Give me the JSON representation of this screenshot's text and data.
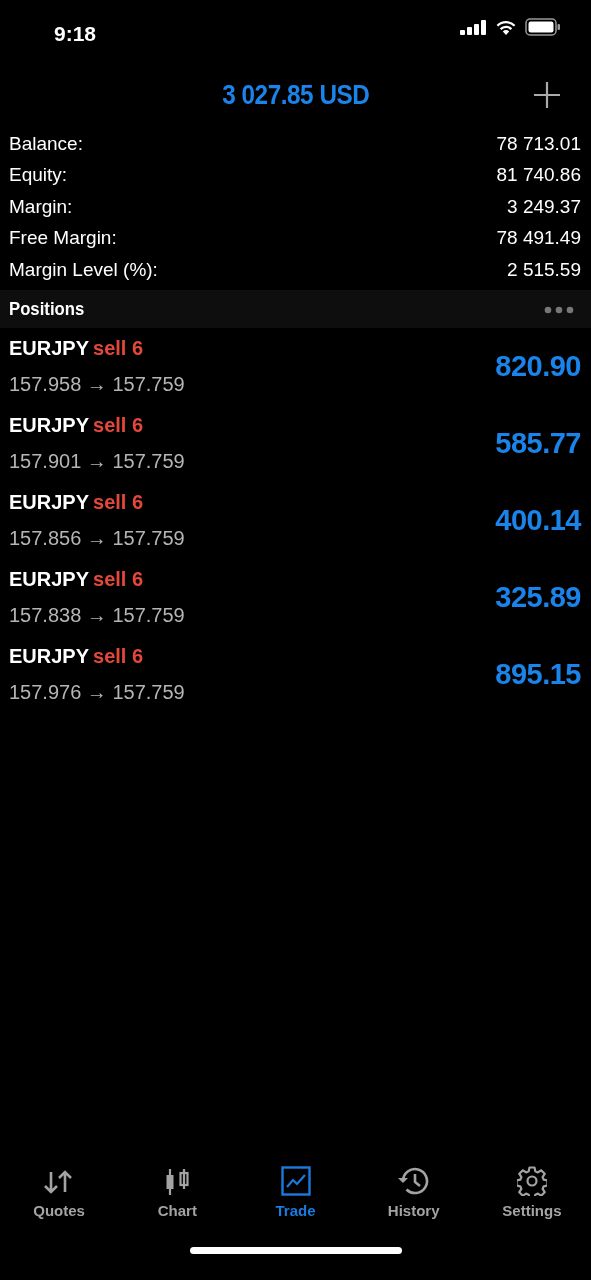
{
  "status_bar": {
    "time": "9:18"
  },
  "header": {
    "title": "3 027.85 USD"
  },
  "summary": [
    {
      "label": "Balance:",
      "value": "78 713.01"
    },
    {
      "label": "Equity:",
      "value": "81 740.86"
    },
    {
      "label": "Margin:",
      "value": "3 249.37"
    },
    {
      "label": "Free Margin:",
      "value": "78 491.49"
    },
    {
      "label": "Margin Level (%):",
      "value": "2 515.59"
    }
  ],
  "positions_header": {
    "title": "Positions"
  },
  "positions": [
    {
      "symbol": "EURJPY",
      "order": "sell 6",
      "prices": "157.958 → 157.759",
      "profit": "820.90"
    },
    {
      "symbol": "EURJPY",
      "order": "sell 6",
      "prices": "157.901 → 157.759",
      "profit": "585.77"
    },
    {
      "symbol": "EURJPY",
      "order": "sell 6",
      "prices": "157.856 → 157.759",
      "profit": "400.14"
    },
    {
      "symbol": "EURJPY",
      "order": "sell 6",
      "prices": "157.838 → 157.759",
      "profit": "325.89"
    },
    {
      "symbol": "EURJPY",
      "order": "sell 6",
      "prices": "157.976 → 157.759",
      "profit": "895.15"
    }
  ],
  "tab_bar": [
    {
      "label": "Quotes",
      "selected": false
    },
    {
      "label": "Chart",
      "selected": false
    },
    {
      "label": "Trade",
      "selected": true
    },
    {
      "label": "History",
      "selected": false
    },
    {
      "label": "Settings",
      "selected": false
    }
  ]
}
